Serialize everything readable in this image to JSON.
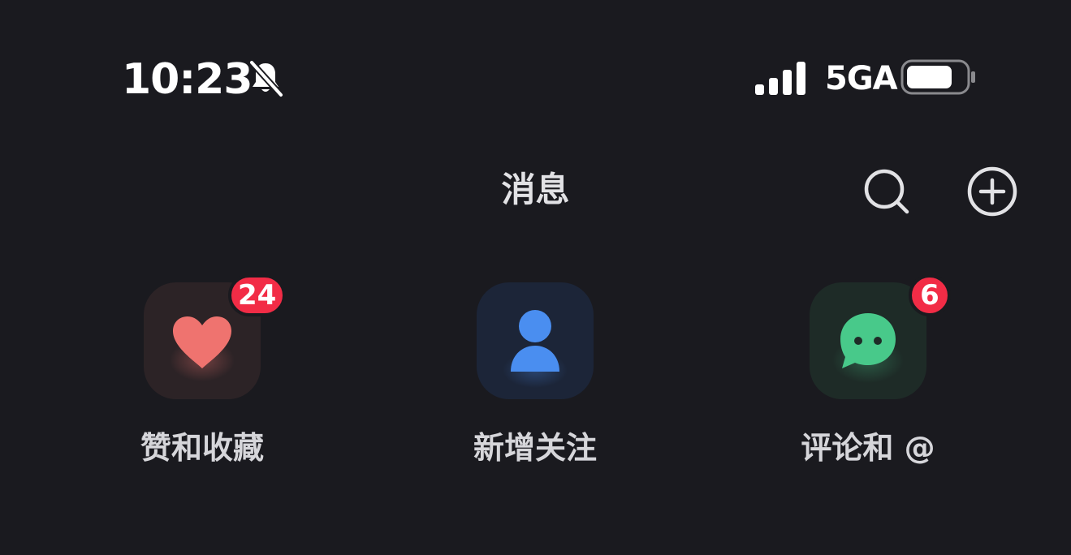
{
  "status_bar": {
    "time": "10:23",
    "network": "5GA",
    "icons": [
      "bell-off-icon",
      "signal-icon",
      "battery-icon"
    ]
  },
  "header": {
    "title": "消息",
    "actions": [
      {
        "icon": "search-icon"
      },
      {
        "icon": "add-circle-icon"
      }
    ]
  },
  "entries": [
    {
      "label": "赞和收藏",
      "icon": "heart-icon",
      "badge": "24",
      "accent": "#ef736f"
    },
    {
      "label": "新增关注",
      "icon": "person-icon",
      "badge": "",
      "accent": "#4a8ef0"
    },
    {
      "label": "评论和 @",
      "icon": "chat-bubble-icon",
      "badge": "6",
      "accent": "#48c98a"
    }
  ],
  "colors": {
    "background": "#1a1a1f",
    "badge": "#f22c46"
  }
}
